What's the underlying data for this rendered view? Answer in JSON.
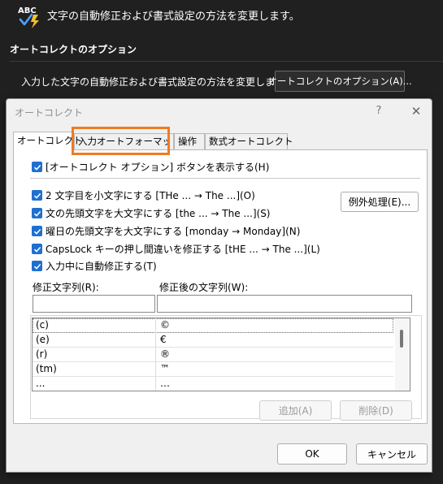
{
  "background": {
    "header_text": "文字の自動修正および書式設定の方法を変更します。",
    "icon_label": "ABC",
    "section_title": "オートコレクトのオプション",
    "row_label": "入力した文字の自動修正および書式設定の方法を変更します:",
    "button_label": "オートコレクトのオプション(A)..."
  },
  "dialog": {
    "title": "オートコレクト",
    "help_glyph": "?",
    "close_glyph": "✕",
    "tabs": [
      {
        "label": "オートコレクト",
        "active": true
      },
      {
        "label": "入力オートフォーマット",
        "active": false
      },
      {
        "label": "操作",
        "active": false
      },
      {
        "label": "数式オートコレクト",
        "active": false
      }
    ],
    "show_buttons_option": "[オートコレクト オプション] ボタンを表示する(H)",
    "options": [
      "2 文字目を小文字にする [THe ... → The ...](O)",
      "文の先頭文字を大文字にする [the ... → The ...](S)",
      "曜日の先頭文字を大文字にする [monday → Monday](N)",
      "CapsLock キーの押し間違いを修正する [tHE ... → The ...](L)"
    ],
    "exceptions_button": "例外処理(E)...",
    "replace_as_you_type": "入力中に自動修正する(T)",
    "replace_label": "修正文字列(R):",
    "with_label": "修正後の文字列(W):",
    "replace_value": "",
    "with_value": "",
    "list": [
      {
        "from": "(c)",
        "to": "©"
      },
      {
        "from": "(e)",
        "to": "€"
      },
      {
        "from": "(r)",
        "to": "®"
      },
      {
        "from": "(tm)",
        "to": "™"
      },
      {
        "from": "...",
        "to": "…"
      }
    ],
    "add_button": "追加(A)",
    "delete_button": "削除(D)",
    "ok_button": "OK",
    "cancel_button": "キャンセル"
  },
  "colors": {
    "accent": "#1f6fd1",
    "highlight": "#f07a23",
    "background": "#202020"
  }
}
